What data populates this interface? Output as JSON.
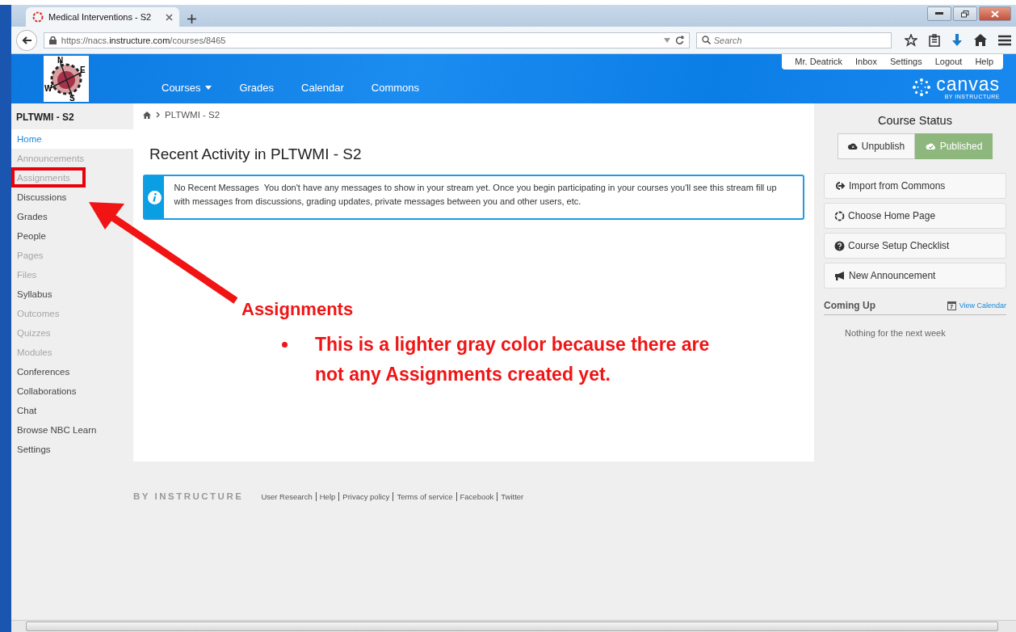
{
  "browser": {
    "tab_title": "Medical Interventions - S2",
    "url": "https://nacs.**instructure.com**/courses/8465",
    "search": {
      "placeholder": "Search"
    }
  },
  "header": {
    "logo_letters": [
      "N",
      "E",
      "W",
      "S"
    ],
    "nav": [
      {
        "label": "Courses",
        "kind": "menu"
      },
      {
        "label": "Grades",
        "kind": "link"
      },
      {
        "label": "Calendar",
        "kind": "link"
      },
      {
        "label": "Commons",
        "kind": "link"
      }
    ],
    "user_links": [
      "Mr. Deatrick",
      "Inbox",
      "Settings",
      "Logout",
      "Help"
    ],
    "brand": "canvas",
    "brand_sub": "BY INSTRUCTURE"
  },
  "sidebar": {
    "title": "PLTWMI - S2",
    "items": [
      {
        "label": "Home",
        "selected": true,
        "disabled": false
      },
      {
        "label": "Announcements",
        "selected": false,
        "disabled": true
      },
      {
        "label": "Assignments",
        "selected": false,
        "disabled": true
      },
      {
        "label": "Discussions",
        "selected": false,
        "disabled": false
      },
      {
        "label": "Grades",
        "selected": false,
        "disabled": false
      },
      {
        "label": "People",
        "selected": false,
        "disabled": false
      },
      {
        "label": "Pages",
        "selected": false,
        "disabled": true
      },
      {
        "label": "Files",
        "selected": false,
        "disabled": true
      },
      {
        "label": "Syllabus",
        "selected": false,
        "disabled": false
      },
      {
        "label": "Outcomes",
        "selected": false,
        "disabled": true
      },
      {
        "label": "Quizzes",
        "selected": false,
        "disabled": true
      },
      {
        "label": "Modules",
        "selected": false,
        "disabled": true
      },
      {
        "label": "Conferences",
        "selected": false,
        "disabled": false
      },
      {
        "label": "Collaborations",
        "selected": false,
        "disabled": false
      },
      {
        "label": "Chat",
        "selected": false,
        "disabled": false
      },
      {
        "label": "Browse NBC Learn",
        "selected": false,
        "disabled": false
      },
      {
        "label": "Settings",
        "selected": false,
        "disabled": false
      }
    ]
  },
  "breadcrumb": [
    "PLTWMI - S2"
  ],
  "heading": "Recent Activity in PLTWMI - S2",
  "alert": {
    "title": "No Recent Messages",
    "message": "You don't have any messages to show in your stream yet. Once you begin participating in your courses you'll see this stream fill up with messages from discussions, grading updates, private messages between you and other users, etc."
  },
  "course_status": {
    "title": "Course Status",
    "options": [
      {
        "label": "Unpublish",
        "selected": false
      },
      {
        "label": "Published",
        "selected": true
      }
    ]
  },
  "actions": [
    {
      "label": "Import from Commons",
      "kind": "import"
    },
    {
      "label": "Choose Home Page",
      "kind": "home"
    },
    {
      "label": "Course Setup Checklist",
      "kind": "help"
    },
    {
      "label": "New Announcement",
      "kind": "announce"
    }
  ],
  "coming_up": {
    "title": "Coming Up",
    "link": "View Calendar",
    "calendar_day": "7",
    "empty": "Nothing for the next week"
  },
  "footer": {
    "brand": "BY INSTRUCTURE",
    "links": [
      "User Research",
      "Help",
      "Privacy policy",
      "Terms of service",
      "Facebook",
      "Twitter"
    ]
  },
  "annotation": {
    "title": "Assignments",
    "bullets": [
      "This is a lighter gray color because there are not any Assignments created yet."
    ]
  }
}
